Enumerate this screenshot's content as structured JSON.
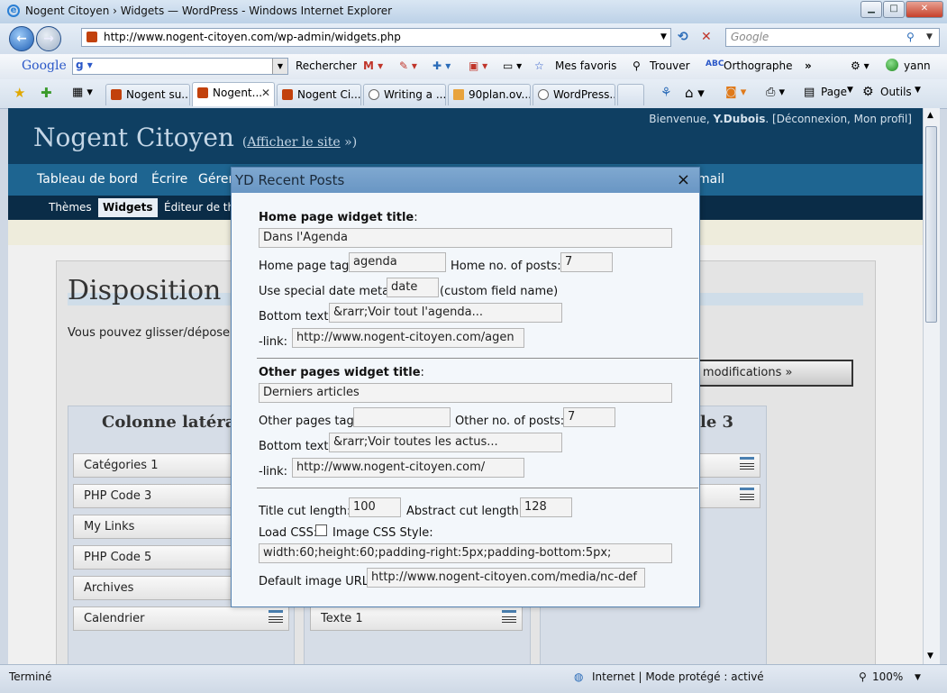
{
  "browser": {
    "window_title": "Nogent Citoyen › Widgets — WordPress - Windows Internet Explorer",
    "address": "http://www.nogent-citoyen.com/wp-admin/widgets.php",
    "search_placeholder": "Google",
    "google_toolbar": {
      "logo": "Google",
      "search_label": "Rechercher",
      "favorites": "Mes favoris",
      "find": "Trouver",
      "spellcheck": "Orthographe",
      "user": "yann"
    },
    "tabs": [
      {
        "label": "Nogent su..."
      },
      {
        "label": "Nogent..."
      },
      {
        "label": "Nogent Ci..."
      },
      {
        "label": "Writing a ..."
      },
      {
        "label": "90plan.ov..."
      },
      {
        "label": "WordPress...."
      }
    ],
    "tab_tools": {
      "page": "Page",
      "tools": "Outils"
    },
    "status_left": "Terminé",
    "status_zone": "Internet | Mode protégé : activé",
    "zoom": "100%"
  },
  "wp": {
    "site_name": "Nogent Citoyen",
    "view_site": "Afficher le site",
    "welcome_prefix": "Bienvenue, ",
    "welcome_user": "Y.Dubois",
    "welcome_suffix": ". [Déconnexion, Mon profil]",
    "main_nav": [
      "Tableau de bord",
      "Écrire",
      "Gérer",
      "mail"
    ],
    "sub_nav": [
      "Thèmes",
      "Widgets",
      "Éditeur de th"
    ],
    "page_title": "Disposition d",
    "intro": "Vous pouvez glisser/déposer",
    "save_button": "es modifications »",
    "col1_title": "Colonne latéral",
    "col3_title": "le 3",
    "col1_widgets": [
      "Catégories 1",
      "PHP Code 3",
      "My Links",
      "PHP Code 5",
      "Archives",
      "Calendrier"
    ],
    "col2_widgets": [
      "Texte 1"
    ]
  },
  "modal": {
    "title": "YD Recent Posts",
    "close": "×",
    "home_title_label": "Home page widget title",
    "home_title_value": "Dans l'Agenda",
    "home_tag_label": "Home page tag:",
    "home_tag_value": "agenda",
    "home_posts_label": "Home no. of posts:",
    "home_posts_value": "7",
    "date_meta_label": "Use special date meta:",
    "date_meta_value": "date",
    "date_meta_hint": "(custom field name)",
    "bottom_text_label": "Bottom text:",
    "home_bottom_text": "&rarr;Voir tout l'agenda...",
    "link_label": "-link:",
    "home_link": "http://www.nogent-citoyen.com/agen",
    "other_title_label": "Other pages widget title",
    "other_title_value": "Derniers articles",
    "other_tag_label": "Other pages tag:",
    "other_tag_value": "",
    "other_posts_label": "Other no. of posts:",
    "other_posts_value": "7",
    "other_bottom_text": "&rarr;Voir toutes les actus...",
    "other_link": "http://www.nogent-citoyen.com/",
    "title_cut_label": "Title cut length:",
    "title_cut_value": "100",
    "abstract_cut_label": "Abstract cut length:",
    "abstract_cut_value": "128",
    "load_css_label": "Load CSS:",
    "image_css_label": "Image CSS Style:",
    "image_css_value": "width:60;height:60;padding-right:5px;padding-bottom:5px;",
    "default_image_label": "Default image URL:",
    "default_image_value": "http://www.nogent-citoyen.com/media/nc-def"
  }
}
